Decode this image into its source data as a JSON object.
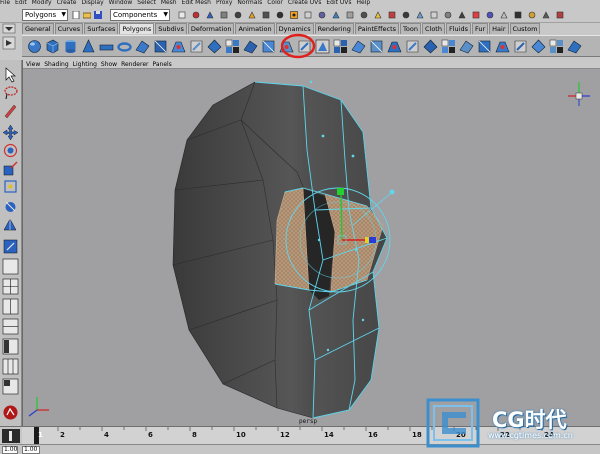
{
  "menubar": {
    "items": [
      "File",
      "Edit",
      "Modify",
      "Create",
      "Display",
      "Window",
      "Select",
      "Mesh",
      "Edit Mesh",
      "Proxy",
      "Normals",
      "Color",
      "Create UVs",
      "Edit UVs",
      "Help"
    ]
  },
  "statusline": {
    "mode_selector": "Polygons",
    "component_field": "Components"
  },
  "shelf": {
    "tabs": [
      "General",
      "Curves",
      "Surfaces",
      "Polygons",
      "Subdivs",
      "Deformation",
      "Animation",
      "Dynamics",
      "Rendering",
      "PaintEffects",
      "Toon",
      "Cloth",
      "Fluids",
      "Fur",
      "Hair",
      "Custom"
    ],
    "active_tab": "Polygons"
  },
  "panel_menu": {
    "items": [
      "View",
      "Shading",
      "Lighting",
      "Show",
      "Renderer",
      "Panels"
    ]
  },
  "viewport": {
    "camera_label": "persp"
  },
  "timeline": {
    "ticks": [
      "1",
      "2",
      "4",
      "6",
      "8",
      "10",
      "12",
      "14",
      "16",
      "18",
      "20",
      "22",
      "24"
    ],
    "current_frame": "1"
  },
  "range": {
    "start": "1.00",
    "end": "1.00"
  },
  "watermark": {
    "text": "CG时代",
    "url": "www.cgtimes.com.cn"
  },
  "colors": {
    "viewport_bg": "#a0a0a3",
    "wireframe": "#5fd6ee",
    "selected_faces": "#b8987a",
    "highlight_circle": "#e0201c"
  }
}
